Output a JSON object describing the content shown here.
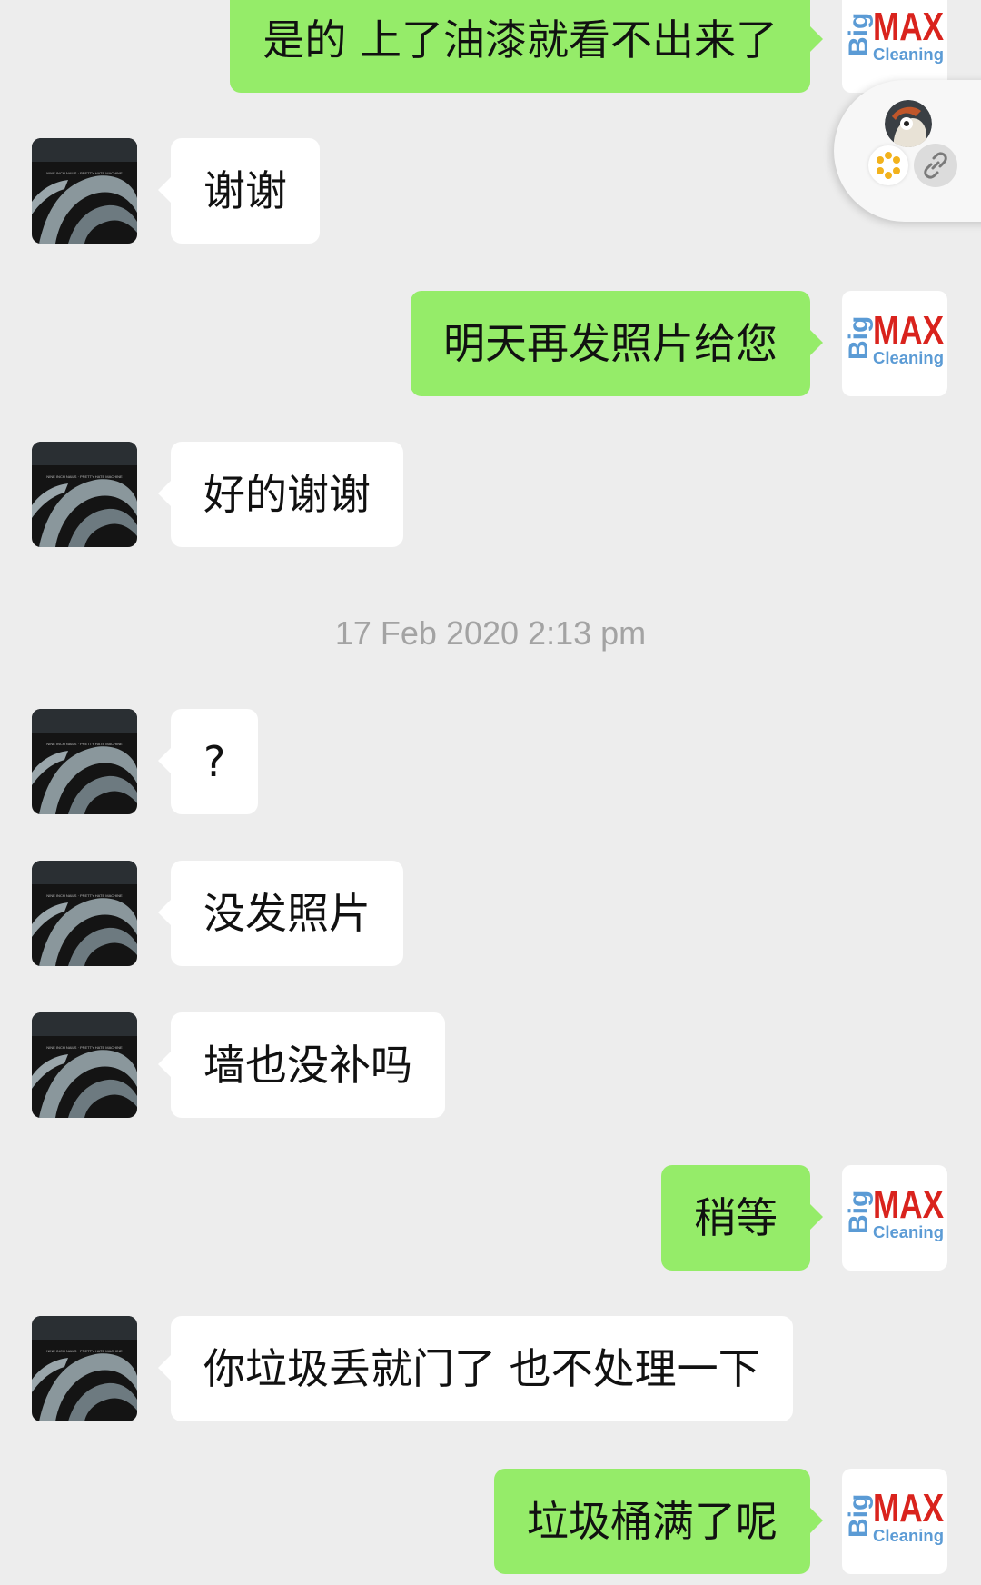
{
  "messages": [
    {
      "side": "out",
      "text": "是的 上了油漆就看不出来了"
    },
    {
      "side": "in",
      "text": "谢谢"
    },
    {
      "side": "out",
      "text": "明天再发照片给您"
    },
    {
      "side": "in",
      "text": "好的谢谢"
    },
    {
      "side": "in",
      "text": "?"
    },
    {
      "side": "in",
      "text": "没发照片"
    },
    {
      "side": "in",
      "text": "墙也没补吗"
    },
    {
      "side": "out",
      "text": "稍等"
    },
    {
      "side": "in",
      "text": "你垃圾丢就门了 也不处理一下"
    },
    {
      "side": "out",
      "text": "垃圾桶满了呢"
    }
  ],
  "timestamp": "17 Feb 2020 2:13 pm",
  "logo": {
    "big": "Big",
    "max": "MAX",
    "cleaning": "Cleaning"
  },
  "avatar_banner_text": "NINE INCH NAILS · PRETTY HATE MACHINE",
  "colors": {
    "background": "#ededed",
    "bubble_out": "#95ec69",
    "bubble_in": "#ffffff",
    "logo_red": "#d9231d",
    "logo_blue": "#5b9bd5"
  }
}
